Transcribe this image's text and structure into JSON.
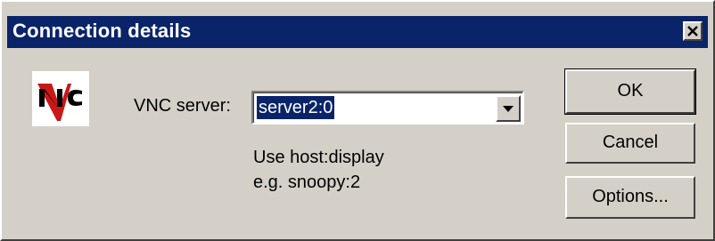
{
  "window": {
    "title": "Connection details",
    "close_icon": "close-icon",
    "title_color": "#0a246a",
    "face_color": "#d4d0c8"
  },
  "logo": {
    "icon": "vnc-logo"
  },
  "server": {
    "label": "VNC server:",
    "value": "server2:0",
    "dropdown_icon": "chevron-down-icon"
  },
  "hint": {
    "line1": "Use host:display",
    "line2": "e.g. snoopy:2"
  },
  "buttons": {
    "ok": "OK",
    "cancel": "Cancel",
    "options": "Options..."
  }
}
